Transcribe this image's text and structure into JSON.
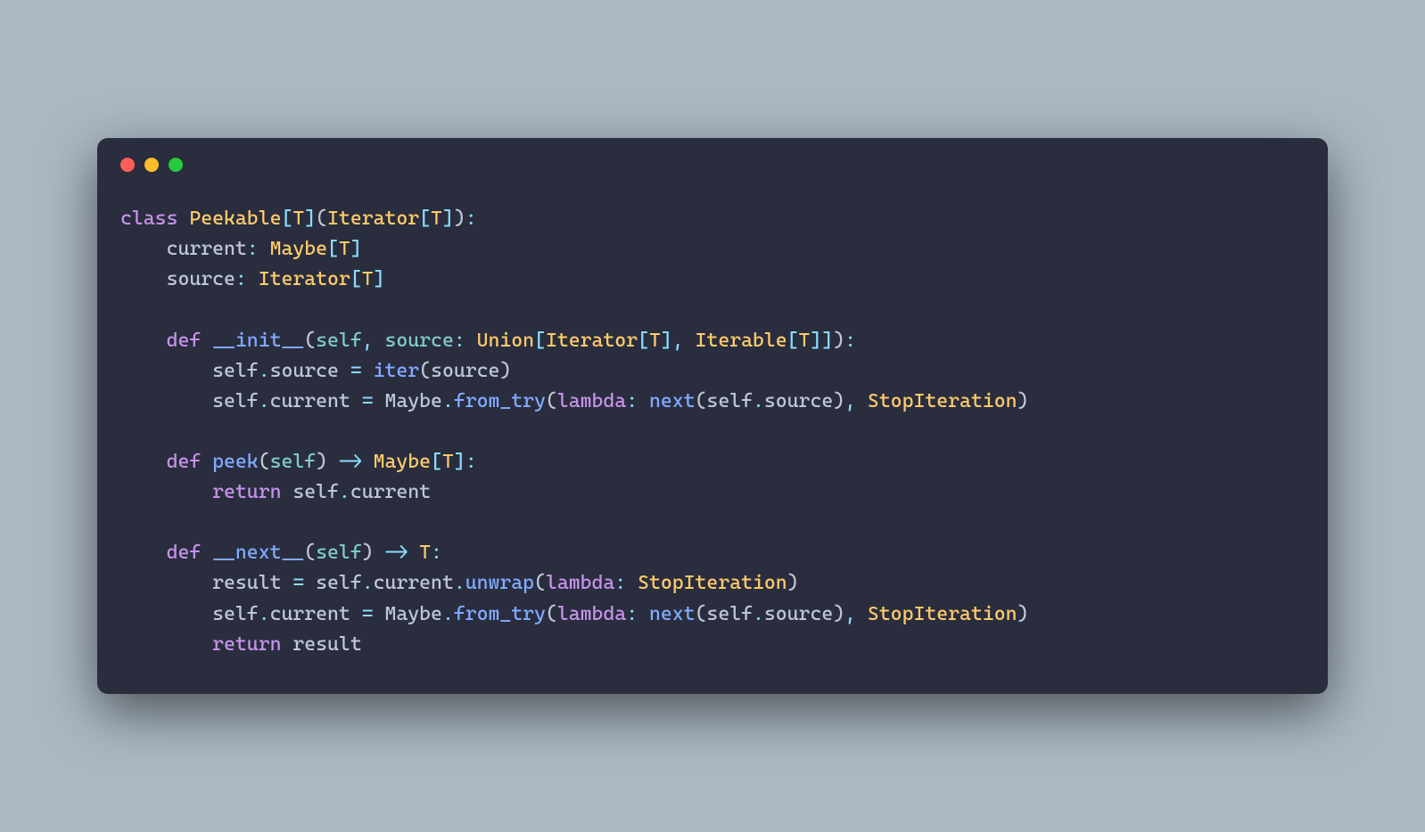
{
  "code": {
    "lines": [
      [
        {
          "cls": "kw",
          "text": "class"
        },
        {
          "cls": "var",
          "text": " "
        },
        {
          "cls": "cls",
          "text": "Peekable"
        },
        {
          "cls": "punc",
          "text": "["
        },
        {
          "cls": "cls",
          "text": "T"
        },
        {
          "cls": "punc",
          "text": "]"
        },
        {
          "cls": "paren",
          "text": "("
        },
        {
          "cls": "cls",
          "text": "Iterator"
        },
        {
          "cls": "punc",
          "text": "["
        },
        {
          "cls": "cls",
          "text": "T"
        },
        {
          "cls": "punc",
          "text": "]"
        },
        {
          "cls": "paren",
          "text": ")"
        },
        {
          "cls": "punc",
          "text": ":"
        }
      ],
      [
        {
          "cls": "var",
          "text": "    current"
        },
        {
          "cls": "punc",
          "text": ": "
        },
        {
          "cls": "cls",
          "text": "Maybe"
        },
        {
          "cls": "punc",
          "text": "["
        },
        {
          "cls": "cls",
          "text": "T"
        },
        {
          "cls": "punc",
          "text": "]"
        }
      ],
      [
        {
          "cls": "var",
          "text": "    source"
        },
        {
          "cls": "punc",
          "text": ": "
        },
        {
          "cls": "cls",
          "text": "Iterator"
        },
        {
          "cls": "punc",
          "text": "["
        },
        {
          "cls": "cls",
          "text": "T"
        },
        {
          "cls": "punc",
          "text": "]"
        }
      ],
      [
        {
          "cls": "var",
          "text": ""
        }
      ],
      [
        {
          "cls": "var",
          "text": "    "
        },
        {
          "cls": "kw",
          "text": "def"
        },
        {
          "cls": "var",
          "text": " "
        },
        {
          "cls": "fn",
          "text": "__init__"
        },
        {
          "cls": "paren",
          "text": "("
        },
        {
          "cls": "prop",
          "text": "self"
        },
        {
          "cls": "punc",
          "text": ", "
        },
        {
          "cls": "prop",
          "text": "source"
        },
        {
          "cls": "punc",
          "text": ": "
        },
        {
          "cls": "cls",
          "text": "Union"
        },
        {
          "cls": "punc",
          "text": "["
        },
        {
          "cls": "cls",
          "text": "Iterator"
        },
        {
          "cls": "punc",
          "text": "["
        },
        {
          "cls": "cls",
          "text": "T"
        },
        {
          "cls": "punc",
          "text": "], "
        },
        {
          "cls": "cls",
          "text": "Iterable"
        },
        {
          "cls": "punc",
          "text": "["
        },
        {
          "cls": "cls",
          "text": "T"
        },
        {
          "cls": "punc",
          "text": "]]"
        },
        {
          "cls": "paren",
          "text": ")"
        },
        {
          "cls": "punc",
          "text": ":"
        }
      ],
      [
        {
          "cls": "var",
          "text": "        self"
        },
        {
          "cls": "punc",
          "text": "."
        },
        {
          "cls": "var",
          "text": "source "
        },
        {
          "cls": "op",
          "text": "="
        },
        {
          "cls": "var",
          "text": " "
        },
        {
          "cls": "fn",
          "text": "iter"
        },
        {
          "cls": "paren",
          "text": "("
        },
        {
          "cls": "var",
          "text": "source"
        },
        {
          "cls": "paren",
          "text": ")"
        }
      ],
      [
        {
          "cls": "var",
          "text": "        self"
        },
        {
          "cls": "punc",
          "text": "."
        },
        {
          "cls": "var",
          "text": "current "
        },
        {
          "cls": "op",
          "text": "="
        },
        {
          "cls": "var",
          "text": " Maybe"
        },
        {
          "cls": "punc",
          "text": "."
        },
        {
          "cls": "fn",
          "text": "from_try"
        },
        {
          "cls": "paren",
          "text": "("
        },
        {
          "cls": "kw",
          "text": "lambda"
        },
        {
          "cls": "punc",
          "text": ": "
        },
        {
          "cls": "fn",
          "text": "next"
        },
        {
          "cls": "paren",
          "text": "("
        },
        {
          "cls": "var",
          "text": "self"
        },
        {
          "cls": "punc",
          "text": "."
        },
        {
          "cls": "var",
          "text": "source"
        },
        {
          "cls": "paren",
          "text": ")"
        },
        {
          "cls": "punc",
          "text": ", "
        },
        {
          "cls": "cls",
          "text": "StopIteration"
        },
        {
          "cls": "paren",
          "text": ")"
        }
      ],
      [
        {
          "cls": "var",
          "text": ""
        }
      ],
      [
        {
          "cls": "var",
          "text": "    "
        },
        {
          "cls": "kw",
          "text": "def"
        },
        {
          "cls": "var",
          "text": " "
        },
        {
          "cls": "fn",
          "text": "peek"
        },
        {
          "cls": "paren",
          "text": "("
        },
        {
          "cls": "prop",
          "text": "self"
        },
        {
          "cls": "paren",
          "text": ")"
        },
        {
          "cls": "var",
          "text": " "
        },
        {
          "cls": "op",
          "text": "->"
        },
        {
          "cls": "var",
          "text": " "
        },
        {
          "cls": "cls",
          "text": "Maybe"
        },
        {
          "cls": "punc",
          "text": "["
        },
        {
          "cls": "cls",
          "text": "T"
        },
        {
          "cls": "punc",
          "text": "]:"
        }
      ],
      [
        {
          "cls": "var",
          "text": "        "
        },
        {
          "cls": "kw",
          "text": "return"
        },
        {
          "cls": "var",
          "text": " self"
        },
        {
          "cls": "punc",
          "text": "."
        },
        {
          "cls": "var",
          "text": "current"
        }
      ],
      [
        {
          "cls": "var",
          "text": ""
        }
      ],
      [
        {
          "cls": "var",
          "text": "    "
        },
        {
          "cls": "kw",
          "text": "def"
        },
        {
          "cls": "var",
          "text": " "
        },
        {
          "cls": "fn",
          "text": "__next__"
        },
        {
          "cls": "paren",
          "text": "("
        },
        {
          "cls": "prop",
          "text": "self"
        },
        {
          "cls": "paren",
          "text": ")"
        },
        {
          "cls": "var",
          "text": " "
        },
        {
          "cls": "op",
          "text": "->"
        },
        {
          "cls": "var",
          "text": " "
        },
        {
          "cls": "cls",
          "text": "T"
        },
        {
          "cls": "punc",
          "text": ":"
        }
      ],
      [
        {
          "cls": "var",
          "text": "        result "
        },
        {
          "cls": "op",
          "text": "="
        },
        {
          "cls": "var",
          "text": " self"
        },
        {
          "cls": "punc",
          "text": "."
        },
        {
          "cls": "var",
          "text": "current"
        },
        {
          "cls": "punc",
          "text": "."
        },
        {
          "cls": "fn",
          "text": "unwrap"
        },
        {
          "cls": "paren",
          "text": "("
        },
        {
          "cls": "kw",
          "text": "lambda"
        },
        {
          "cls": "punc",
          "text": ": "
        },
        {
          "cls": "cls",
          "text": "StopIteration"
        },
        {
          "cls": "paren",
          "text": ")"
        }
      ],
      [
        {
          "cls": "var",
          "text": "        self"
        },
        {
          "cls": "punc",
          "text": "."
        },
        {
          "cls": "var",
          "text": "current "
        },
        {
          "cls": "op",
          "text": "="
        },
        {
          "cls": "var",
          "text": " Maybe"
        },
        {
          "cls": "punc",
          "text": "."
        },
        {
          "cls": "fn",
          "text": "from_try"
        },
        {
          "cls": "paren",
          "text": "("
        },
        {
          "cls": "kw",
          "text": "lambda"
        },
        {
          "cls": "punc",
          "text": ": "
        },
        {
          "cls": "fn",
          "text": "next"
        },
        {
          "cls": "paren",
          "text": "("
        },
        {
          "cls": "var",
          "text": "self"
        },
        {
          "cls": "punc",
          "text": "."
        },
        {
          "cls": "var",
          "text": "source"
        },
        {
          "cls": "paren",
          "text": ")"
        },
        {
          "cls": "punc",
          "text": ", "
        },
        {
          "cls": "cls",
          "text": "StopIteration"
        },
        {
          "cls": "paren",
          "text": ")"
        }
      ],
      [
        {
          "cls": "var",
          "text": "        "
        },
        {
          "cls": "kw",
          "text": "return"
        },
        {
          "cls": "var",
          "text": " result"
        }
      ]
    ]
  }
}
